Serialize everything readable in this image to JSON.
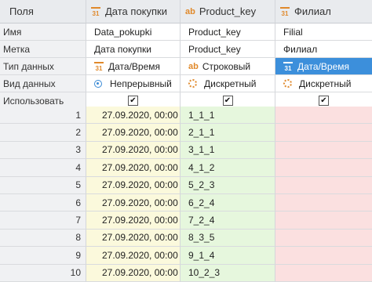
{
  "header": {
    "col0": "Поля",
    "col1": "Дата покупки",
    "col2": "Product_key",
    "col3": "Филиал",
    "col1_icon": "calendar-icon",
    "col2_icon": "text-type-icon",
    "col3_icon": "calendar-icon"
  },
  "meta_rows": [
    {
      "label": "Имя",
      "c1": "Data_pokupki",
      "c2": "Product_key",
      "c3": "Filial"
    },
    {
      "label": "Метка",
      "c1": "Дата покупки",
      "c2": "Product_key",
      "c3": "Филиал"
    },
    {
      "label": "Тип данных",
      "c1": "Дата/Время",
      "c2": "Строковый",
      "c3": "Дата/Время"
    },
    {
      "label": "Вид данных",
      "c1": "Непрерывный",
      "c2": "Дискретный",
      "c3": "Дискретный"
    },
    {
      "label": "Использовать",
      "c1": true,
      "c2": true,
      "c3": true
    }
  ],
  "icons": {
    "checkbox_mark": "✔",
    "calendar_glyph": "31",
    "text_glyph": "ab"
  },
  "selected_cell": "type-filial",
  "colors": {
    "date_column_bg": "#fbf9dc",
    "string_column_bg": "#e6f7dd",
    "filial_column_bg": "#fbe0e0",
    "selection": "#3c8fdb"
  },
  "data_rows": [
    {
      "n": "1",
      "date": "27.09.2020, 00:00",
      "key": "1_1_1",
      "filial": ""
    },
    {
      "n": "2",
      "date": "27.09.2020, 00:00",
      "key": "2_1_1",
      "filial": ""
    },
    {
      "n": "3",
      "date": "27.09.2020, 00:00",
      "key": "3_1_1",
      "filial": ""
    },
    {
      "n": "4",
      "date": "27.09.2020, 00:00",
      "key": "4_1_2",
      "filial": ""
    },
    {
      "n": "5",
      "date": "27.09.2020, 00:00",
      "key": "5_2_3",
      "filial": ""
    },
    {
      "n": "6",
      "date": "27.09.2020, 00:00",
      "key": "6_2_4",
      "filial": ""
    },
    {
      "n": "7",
      "date": "27.09.2020, 00:00",
      "key": "7_2_4",
      "filial": ""
    },
    {
      "n": "8",
      "date": "27.09.2020, 00:00",
      "key": "8_3_5",
      "filial": ""
    },
    {
      "n": "9",
      "date": "27.09.2020, 00:00",
      "key": "9_1_4",
      "filial": ""
    },
    {
      "n": "10",
      "date": "27.09.2020, 00:00",
      "key": "10_2_3",
      "filial": ""
    }
  ]
}
